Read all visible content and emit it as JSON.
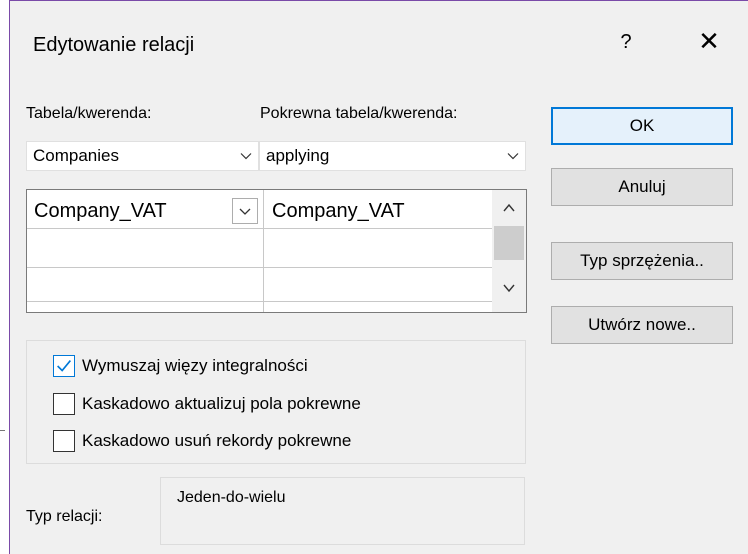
{
  "dialog": {
    "title": "Edytowanie relacji",
    "help_label": "?",
    "close_label": "✕"
  },
  "form": {
    "table_label": "Tabela/kwerenda:",
    "related_label": "Pokrewna tabela/kwerenda:",
    "table_value": "Companies",
    "related_value": "applying"
  },
  "grid": {
    "rows": [
      {
        "left": "Company_VAT",
        "right": "Company_VAT"
      },
      {
        "left": "",
        "right": ""
      },
      {
        "left": "",
        "right": ""
      }
    ]
  },
  "options": {
    "enforce_label": "Wymuszaj więzy integralności",
    "enforce_checked": true,
    "cascade_update_label": "Kaskadowo aktualizuj pola pokrewne",
    "cascade_update_checked": false,
    "cascade_delete_label": "Kaskadowo usuń rekordy pokrewne",
    "cascade_delete_checked": false
  },
  "relation": {
    "label": "Typ relacji:",
    "value": "Jeden-do-wielu"
  },
  "buttons": {
    "ok": "OK",
    "cancel": "Anuluj",
    "join_type": "Typ sprzężenia..",
    "create_new": "Utwórz nowe.."
  },
  "colors": {
    "accent": "#0078d7",
    "window_border": "#7a4aa8"
  }
}
